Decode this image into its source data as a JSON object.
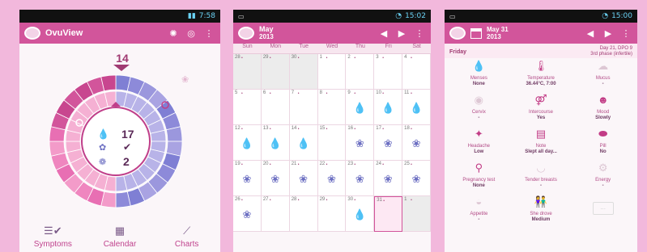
{
  "phone1": {
    "status_time": "7:58",
    "title": "OvuView",
    "day": "14",
    "stat_days": "17",
    "stat_count": "2",
    "nav": [
      {
        "label": "Symptoms",
        "icon": "symptoms-icon"
      },
      {
        "label": "Calendar",
        "icon": "calendar-icon"
      },
      {
        "label": "Charts",
        "icon": "chart-icon"
      }
    ]
  },
  "phone2": {
    "status_time": "15:02",
    "month": "May",
    "year": "2013",
    "weekdays": [
      "Sun",
      "Mon",
      "Tue",
      "Wed",
      "Thu",
      "Fri",
      "Sat"
    ],
    "weeks": [
      [
        {
          "d": "28",
          "o": 1
        },
        {
          "d": "29",
          "o": 1
        },
        {
          "d": "30",
          "o": 1
        },
        {
          "d": "1"
        },
        {
          "d": "2"
        },
        {
          "d": "3"
        },
        {
          "d": "4"
        }
      ],
      [
        {
          "d": "5"
        },
        {
          "d": "6"
        },
        {
          "d": "7"
        },
        {
          "d": "8"
        },
        {
          "d": "9",
          "i": "drop2"
        },
        {
          "d": "10",
          "i": "drop"
        },
        {
          "d": "11",
          "i": "drop"
        }
      ],
      [
        {
          "d": "12",
          "i": "drop"
        },
        {
          "d": "13",
          "i": "drop"
        },
        {
          "d": "14",
          "i": "drop"
        },
        {
          "d": "15"
        },
        {
          "d": "16",
          "i": "flower"
        },
        {
          "d": "17",
          "i": "flower"
        },
        {
          "d": "18",
          "i": "flower"
        }
      ],
      [
        {
          "d": "19",
          "i": "flower"
        },
        {
          "d": "20",
          "i": "flower"
        },
        {
          "d": "21",
          "i": "flower"
        },
        {
          "d": "22",
          "i": "flower"
        },
        {
          "d": "23",
          "i": "flower"
        },
        {
          "d": "24",
          "i": "flower"
        },
        {
          "d": "25",
          "i": "flower"
        }
      ],
      [
        {
          "d": "26",
          "i": "flower"
        },
        {
          "d": "27"
        },
        {
          "d": "28"
        },
        {
          "d": "29"
        },
        {
          "d": "30",
          "i": "drop2"
        },
        {
          "d": "31",
          "sel": 1
        },
        {
          "d": "1",
          "o": 1
        }
      ]
    ]
  },
  "phone3": {
    "status_time": "15:00",
    "date_title": "May 31",
    "year": "2013",
    "weekday": "Friday",
    "cycle_info": "Day 21, DPO 9",
    "phase_info": "3rd phase (infertile)",
    "items": [
      {
        "label": "Menses",
        "value": "None",
        "icon": "drop-icon",
        "glyph": "💧",
        "on": true
      },
      {
        "label": "Temperature",
        "value": "36.44°C, 7:00",
        "icon": "thermometer-icon",
        "glyph": "🌡",
        "on": true
      },
      {
        "label": "Mucus",
        "value": "",
        "icon": "mucus-icon",
        "glyph": "☁",
        "on": false
      },
      {
        "label": "Cervix",
        "value": "",
        "icon": "cervix-icon",
        "glyph": "◉",
        "on": false
      },
      {
        "label": "Intercourse",
        "value": "Yes",
        "icon": "gender-icon",
        "glyph": "⚤",
        "on": true
      },
      {
        "label": "Mood",
        "value": "Slowly",
        "icon": "mood-icon",
        "glyph": "☻",
        "on": true
      },
      {
        "label": "Headache",
        "value": "Low",
        "icon": "headache-icon",
        "glyph": "✦",
        "on": true
      },
      {
        "label": "Note",
        "value": "Slept all day...",
        "icon": "note-icon",
        "glyph": "▤",
        "on": true
      },
      {
        "label": "Pill",
        "value": "No",
        "icon": "pill-icon",
        "glyph": "⬬",
        "on": true
      },
      {
        "label": "Pregnancy test",
        "value": "None",
        "icon": "pregnancy-test-icon",
        "glyph": "⚲",
        "on": true
      },
      {
        "label": "Tender breasts",
        "value": "",
        "icon": "breast-icon",
        "glyph": "◡",
        "on": false
      },
      {
        "label": "Energy",
        "value": "",
        "icon": "energy-icon",
        "glyph": "⚙",
        "on": false
      },
      {
        "label": "Appetite",
        "value": "",
        "icon": "appetite-icon",
        "glyph": "◒",
        "on": false
      },
      {
        "label": "She drove",
        "value": "Medium",
        "icon": "people-icon",
        "glyph": "👫",
        "on": true
      }
    ]
  }
}
